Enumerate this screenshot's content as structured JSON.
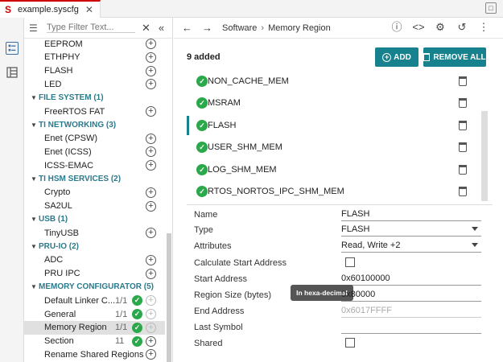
{
  "window": {
    "tab_title": "example.syscfg",
    "tab_close": "✕",
    "restore_icon": "□"
  },
  "tree": {
    "filter_placeholder": "Type Filter Text...",
    "rows": [
      {
        "label": "EEPROM",
        "type": "item"
      },
      {
        "label": "ETHPHY",
        "type": "item"
      },
      {
        "label": "FLASH",
        "type": "item"
      },
      {
        "label": "LED",
        "type": "item"
      },
      {
        "label": "FILE SYSTEM (1)",
        "type": "category"
      },
      {
        "label": "FreeRTOS FAT",
        "type": "item"
      },
      {
        "label": "TI NETWORKING (3)",
        "type": "category"
      },
      {
        "label": "Enet (CPSW)",
        "type": "item"
      },
      {
        "label": "Enet (ICSS)",
        "type": "item"
      },
      {
        "label": "ICSS-EMAC",
        "type": "item"
      },
      {
        "label": "TI HSM SERVICES (2)",
        "type": "category"
      },
      {
        "label": "Crypto",
        "type": "item"
      },
      {
        "label": "SA2UL",
        "type": "item"
      },
      {
        "label": "USB (1)",
        "type": "category"
      },
      {
        "label": "TinyUSB",
        "type": "item"
      },
      {
        "label": "PRU-IO (2)",
        "type": "category"
      },
      {
        "label": "ADC",
        "type": "item"
      },
      {
        "label": "PRU IPC",
        "type": "item"
      },
      {
        "label": "MEMORY CONFIGURATOR (5)",
        "type": "category"
      },
      {
        "label": "Default Linker C...",
        "type": "item",
        "count": "1/1",
        "check": true,
        "disabled": true
      },
      {
        "label": "General",
        "type": "item",
        "count": "1/1",
        "check": true,
        "disabled": true
      },
      {
        "label": "Memory Region",
        "type": "item",
        "count": "1/1",
        "check": true,
        "disabled": true,
        "selected": true
      },
      {
        "label": "Section",
        "type": "item",
        "count": "11",
        "check": true
      },
      {
        "label": "Rename Shared Regions",
        "type": "item"
      }
    ]
  },
  "breadcrumb": {
    "part1": "Software",
    "separator": "›",
    "part2": "Memory Region"
  },
  "instances": {
    "added_label": "9 added",
    "add_button": "ADD",
    "remove_all_button": "REMOVE ALL",
    "items": [
      "NON_CACHE_MEM",
      "MSRAM",
      "FLASH",
      "USER_SHM_MEM",
      "LOG_SHM_MEM",
      "RTOS_NORTOS_IPC_SHM_MEM"
    ],
    "selected_index": 2
  },
  "properties": {
    "name": {
      "label": "Name",
      "value": "FLASH"
    },
    "type": {
      "label": "Type",
      "value": "FLASH"
    },
    "attributes": {
      "label": "Attributes",
      "value": "Read, Write +2"
    },
    "calc_start": {
      "label": "Calculate Start Address",
      "checked": false
    },
    "start_address": {
      "label": "Start Address",
      "value": "0x60100000"
    },
    "region_size": {
      "label": "Region Size (bytes)",
      "value": "0x80000",
      "tooltip": "In hexa-decimal"
    },
    "end_address": {
      "label": "End Address",
      "value": "0x6017FFFF"
    },
    "last_symbol": {
      "label": "Last Symbol",
      "value": ""
    },
    "shared": {
      "label": "Shared",
      "checked": false
    }
  },
  "colors": {
    "accent": "#17818e",
    "category": "#2b7a8c",
    "check": "#2aa84a",
    "logo": "#cc0000"
  }
}
